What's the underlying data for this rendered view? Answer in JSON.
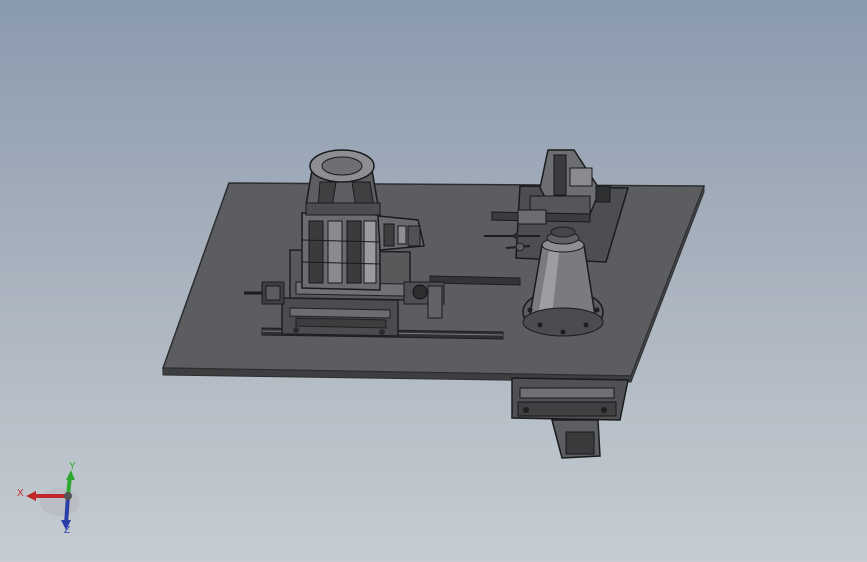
{
  "colors": {
    "background_top": "#8a9aae",
    "background_bottom": "#c6ccd2",
    "plate": "#5f6062",
    "plate_edge": "#3a3b3d",
    "part_dark": "#4a4b4d",
    "part_mid": "#6f7073",
    "part_light": "#8c8d90",
    "rail": "#2f3032",
    "x_axis": "#c0262b",
    "y_axis": "#2fa82f",
    "z_axis": "#2a3fa8"
  },
  "triad": {
    "x_label": "X",
    "y_label": "Y",
    "z_label": "Z"
  },
  "icons": {
    "triad": "coordinate-triad-icon"
  }
}
